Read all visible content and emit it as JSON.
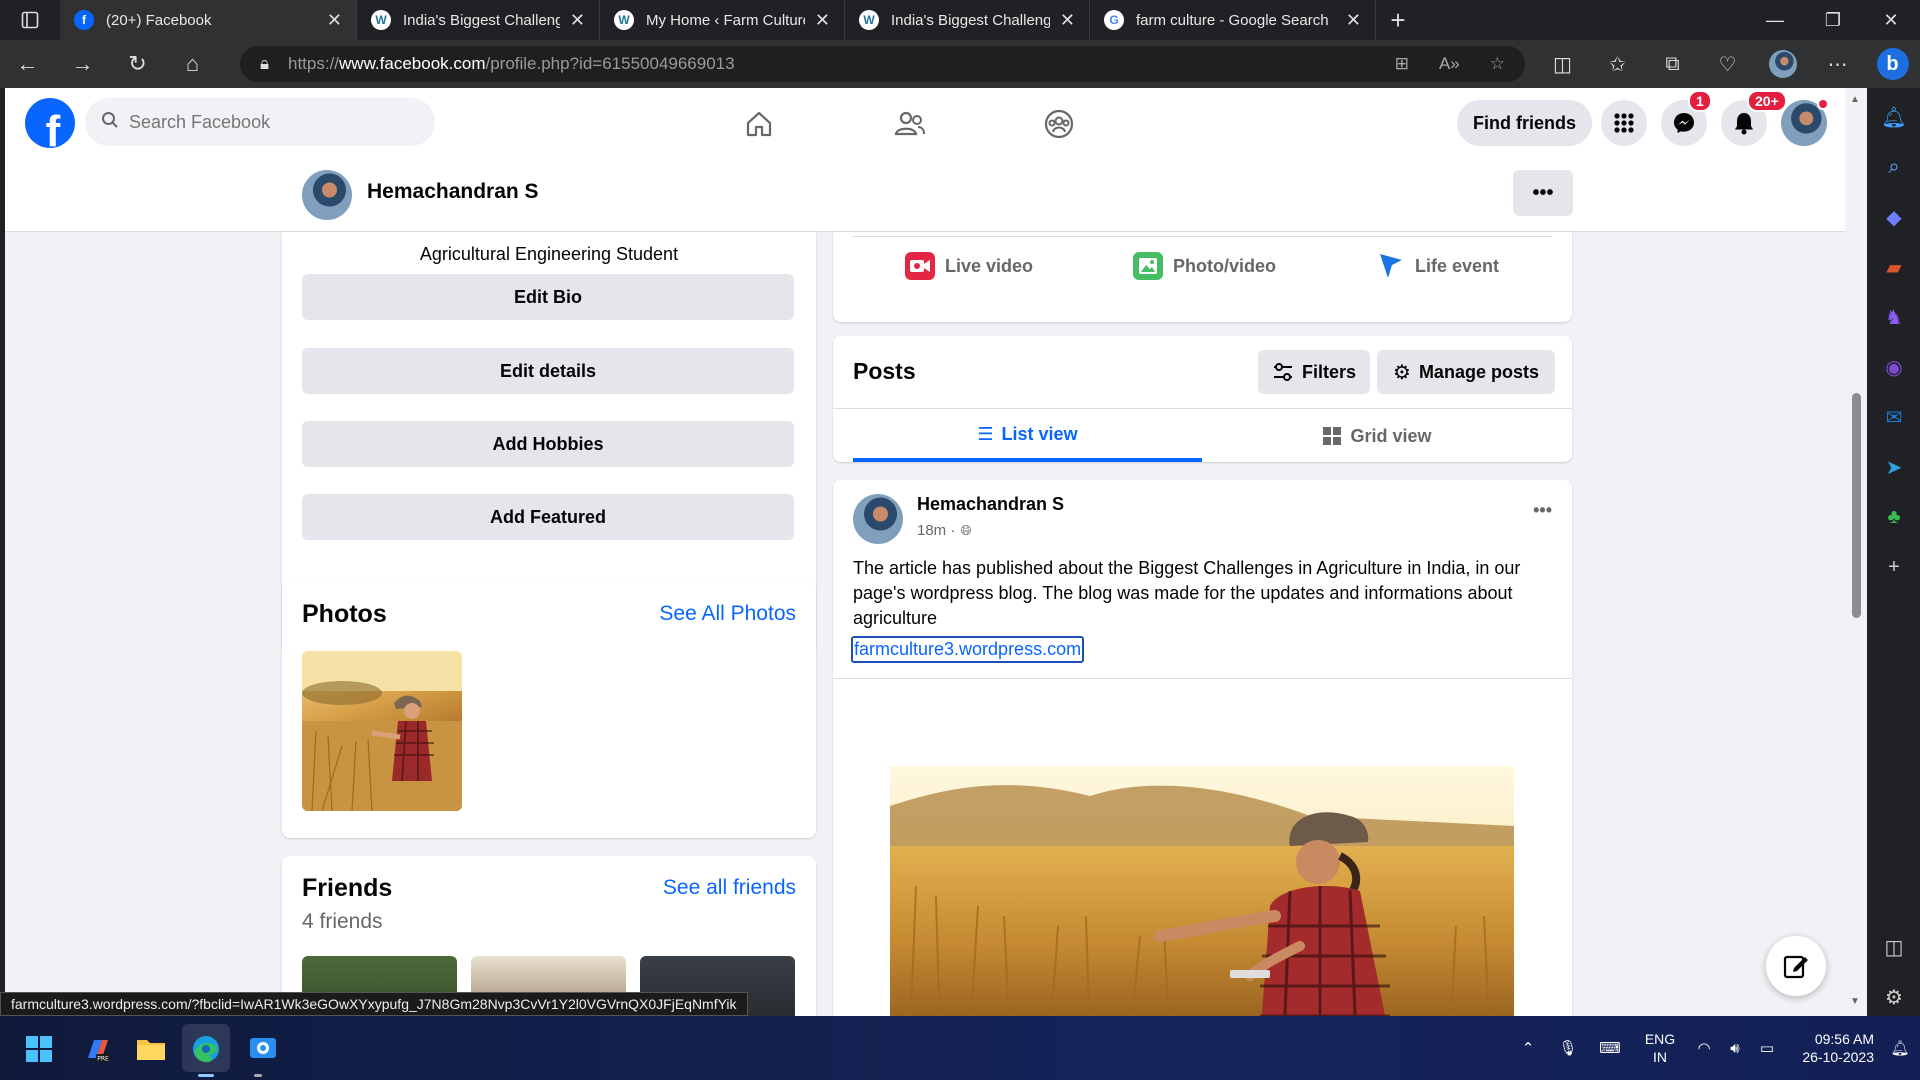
{
  "browser": {
    "tabs": [
      {
        "title": "(20+) Facebook",
        "active": true
      },
      {
        "title": "India's Biggest Challenge: The Fu",
        "active": false
      },
      {
        "title": "My Home ‹ Farm Culture — Wor",
        "active": false
      },
      {
        "title": "India's Biggest Challenge: The Fu",
        "active": false
      },
      {
        "title": "farm culture - Google Search",
        "active": false
      }
    ],
    "url_scheme": "https://",
    "url_host": "www.facebook.com",
    "url_path": "/profile.php?id=61550049669013"
  },
  "facebook": {
    "search_placeholder": "Search Facebook",
    "find_friends": "Find friends",
    "messenger_badge": "1",
    "notifications_badge": "20+",
    "profile_name": "Hemachandran S",
    "intro": {
      "bio": "Agricultural Engineering Student",
      "edit_bio": "Edit Bio",
      "edit_details": "Edit details",
      "add_hobbies": "Add Hobbies",
      "add_featured": "Add Featured"
    },
    "photos": {
      "title": "Photos",
      "see_all": "See All Photos"
    },
    "friends": {
      "title": "Friends",
      "see_all": "See all friends",
      "count": "4 friends"
    },
    "composer": {
      "live": "Live video",
      "photo": "Photo/video",
      "life": "Life event"
    },
    "posts": {
      "title": "Posts",
      "filters": "Filters",
      "manage": "Manage posts",
      "list_view": "List view",
      "grid_view": "Grid view"
    },
    "post": {
      "author": "Hemachandran S",
      "time": "18m ·",
      "text": "The article has published about the Biggest Challenges in Agriculture in India, in our page's wordpress blog. The blog was made for the updates and informations about agriculture",
      "link": "farmculture3.wordpress.com"
    },
    "status_url": "farmculture3.wordpress.com/?fbclid=IwAR1Wk3eGOwXYxypufg_J7N8Gm28Nvp3CvVr1Y2l0VGVrnQX0JFjEqNmfYik"
  },
  "taskbar": {
    "lang_line1": "ENG",
    "lang_line2": "IN",
    "time": "09:56 AM",
    "date": "26-10-2023"
  },
  "colors": {
    "fb_blue": "#0866ff",
    "link_blue": "#0866ff",
    "badge_red": "#e41e3f"
  }
}
